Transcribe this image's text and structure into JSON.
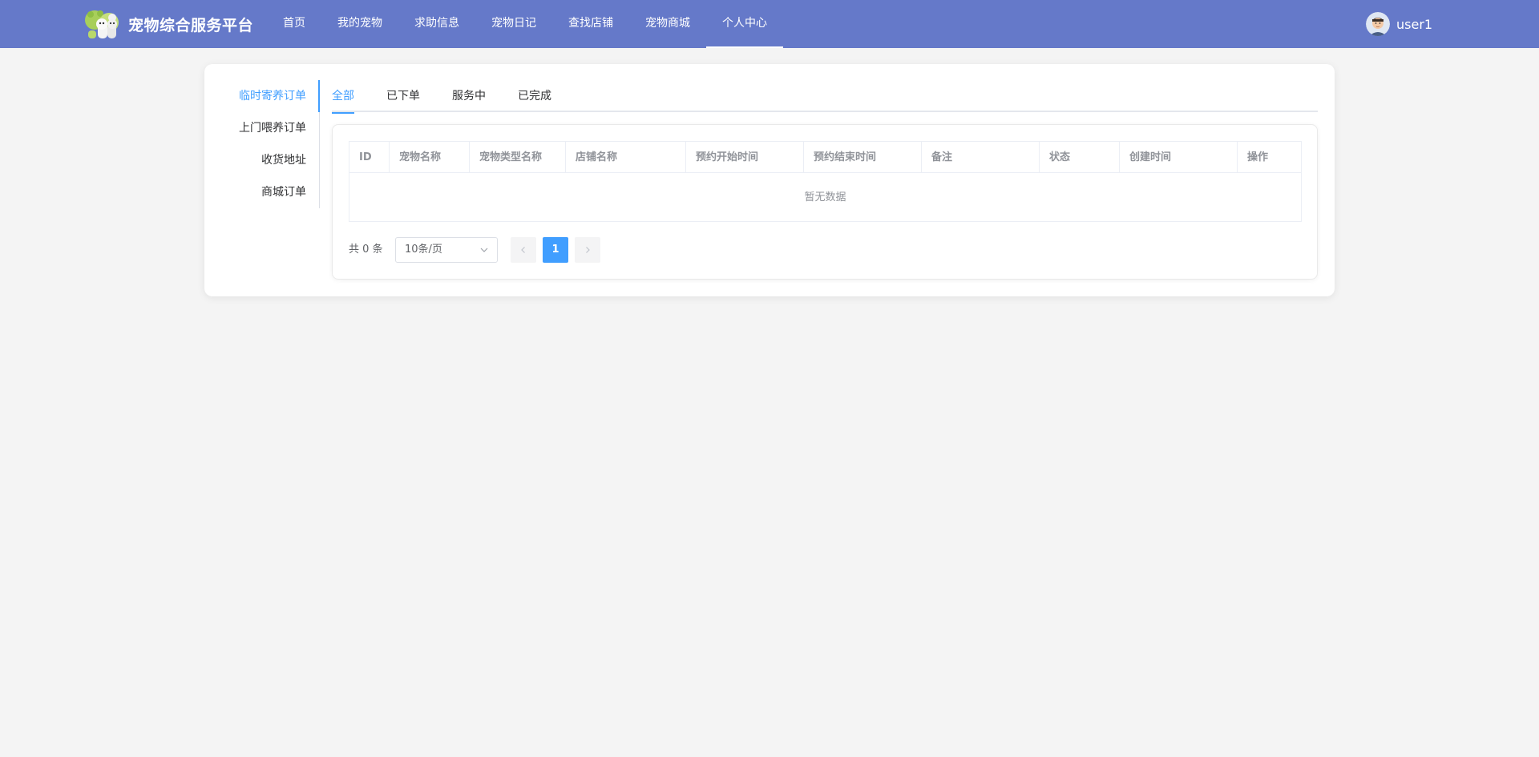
{
  "app": {
    "title": "宠物综合服务平台"
  },
  "nav": {
    "items": [
      {
        "label": "首页"
      },
      {
        "label": "我的宠物"
      },
      {
        "label": "求助信息"
      },
      {
        "label": "宠物日记"
      },
      {
        "label": "查找店铺"
      },
      {
        "label": "宠物商城"
      },
      {
        "label": "个人中心"
      }
    ],
    "active_index": 6
  },
  "user": {
    "name": "user1",
    "avatar_icon": "user-avatar"
  },
  "sidebar": {
    "items": [
      {
        "label": "临时寄养订单"
      },
      {
        "label": "上门喂养订单"
      },
      {
        "label": "收货地址"
      },
      {
        "label": "商城订单"
      }
    ],
    "active_index": 0
  },
  "tabs": {
    "items": [
      {
        "label": "全部"
      },
      {
        "label": "已下单"
      },
      {
        "label": "服务中"
      },
      {
        "label": "已完成"
      }
    ],
    "active_index": 0
  },
  "table": {
    "columns": [
      "ID",
      "宠物名称",
      "宠物类型名称",
      "店铺名称",
      "预约开始时间",
      "预约结束时间",
      "备注",
      "状态",
      "创建时间",
      "操作"
    ],
    "rows": [],
    "empty_text": "暂无数据"
  },
  "pagination": {
    "total_text": "共 0 条",
    "page_size_label": "10条/页",
    "current_page": "1"
  },
  "colors": {
    "topbar": "#6579c9",
    "accent": "#409eff",
    "page_bg": "#f4f4f4"
  }
}
